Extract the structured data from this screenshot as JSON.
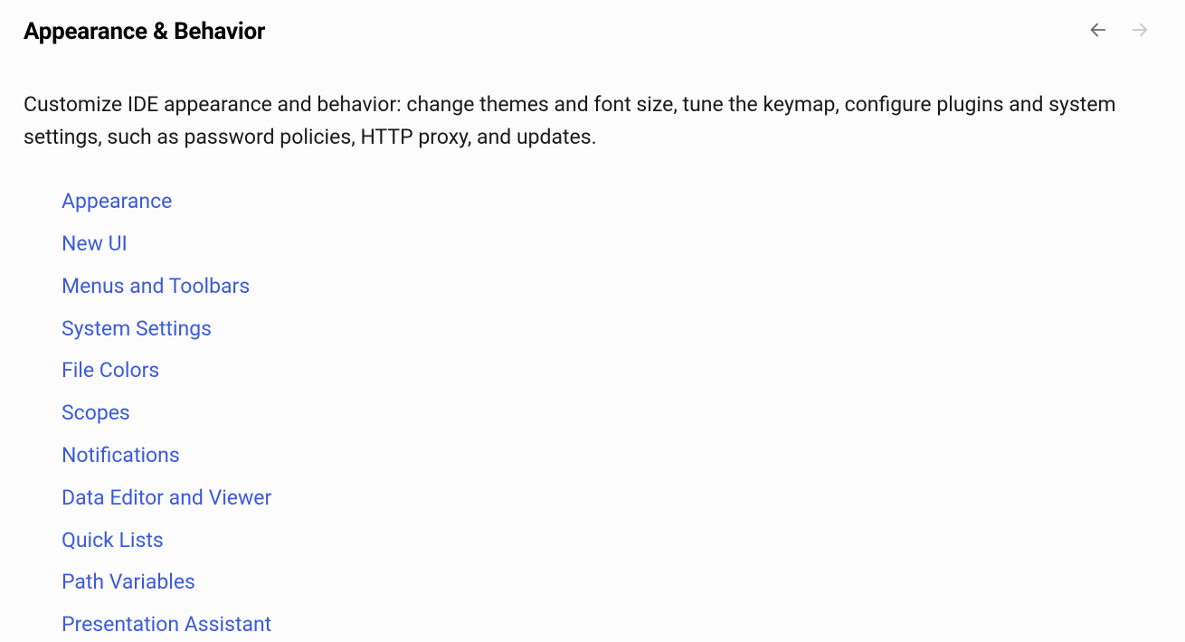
{
  "header": {
    "title": "Appearance & Behavior"
  },
  "description": "Customize IDE appearance and behavior: change themes and font size, tune the keymap, configure plugins and system settings, such as password policies, HTTP proxy, and updates.",
  "links": [
    {
      "label": "Appearance"
    },
    {
      "label": "New UI"
    },
    {
      "label": "Menus and Toolbars"
    },
    {
      "label": "System Settings"
    },
    {
      "label": "File Colors"
    },
    {
      "label": "Scopes"
    },
    {
      "label": "Notifications"
    },
    {
      "label": "Data Editor and Viewer"
    },
    {
      "label": "Quick Lists"
    },
    {
      "label": "Path Variables"
    },
    {
      "label": "Presentation Assistant"
    }
  ]
}
